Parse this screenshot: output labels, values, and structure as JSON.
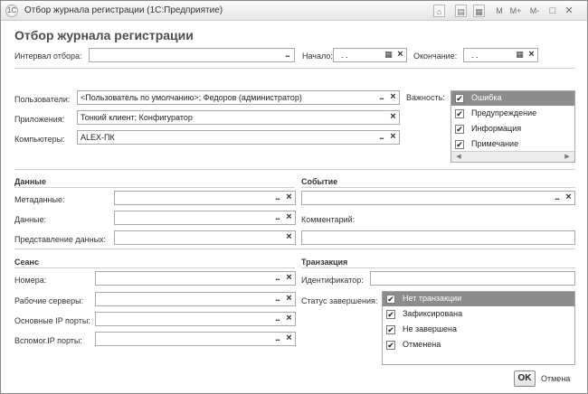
{
  "window": {
    "title": "Отбор журнала регистрации  (1С:Предприятие)",
    "icon": "1c-app-icon",
    "toolbar_buttons": [
      "M",
      "M+",
      "M-"
    ]
  },
  "form": {
    "title": "Отбор журнала регистрации"
  },
  "interval": {
    "label": "Интервал отбора:",
    "value": "",
    "start_label": "Начало:",
    "start_value": ". .",
    "end_label": "Окончание:",
    "end_value": ". ."
  },
  "users": {
    "label": "Пользователи:",
    "value": "<Пользователь по умолчанию>; Федоров (администратор)"
  },
  "apps": {
    "label": "Приложения:",
    "value": "Тонкий клиент; Конфигуратор"
  },
  "computers": {
    "label": "Компьютеры:",
    "value": "ALEX-ПК"
  },
  "severity": {
    "label": "Важность:",
    "items": [
      {
        "label": "Ошибка",
        "checked": true,
        "selected": true
      },
      {
        "label": "Предупреждение",
        "checked": true,
        "selected": false
      },
      {
        "label": "Информация",
        "checked": true,
        "selected": false
      },
      {
        "label": "Примечание",
        "checked": true,
        "selected": false
      }
    ]
  },
  "data_section": {
    "title": "Данные",
    "metadata_label": "Метаданные:",
    "data_label": "Данные:",
    "presentation_label": "Представление данных:"
  },
  "event_section": {
    "title": "Событие",
    "comment_label": "Комментарий:"
  },
  "session_section": {
    "title": "Сеанс",
    "numbers_label": "Номера:",
    "servers_label": "Рабочие серверы:",
    "main_ports_label": "Основные IP порты:",
    "aux_ports_label": "Вспомог.IP порты:"
  },
  "transaction_section": {
    "title": "Транзакция",
    "id_label": "Идентификатор:",
    "status_label": "Статус завершения:",
    "items": [
      {
        "label": "Нет транзакции",
        "checked": true,
        "selected": true
      },
      {
        "label": "Зафиксирована",
        "checked": true,
        "selected": false
      },
      {
        "label": "Не завершена",
        "checked": true,
        "selected": false
      },
      {
        "label": "Отменена",
        "checked": true,
        "selected": false
      }
    ]
  },
  "buttons": {
    "ok": "OK",
    "cancel": "Отмена"
  },
  "glyphs": {
    "dots": "...",
    "clear": "×",
    "check": "✔",
    "calendar": "▦",
    "close": "✕",
    "arrow_left": "◀",
    "arrow_right": "▶"
  },
  "colors": {
    "selection": "#8c8c8c",
    "border": "#a9a9a9",
    "title_text": "#4d4d4d"
  }
}
